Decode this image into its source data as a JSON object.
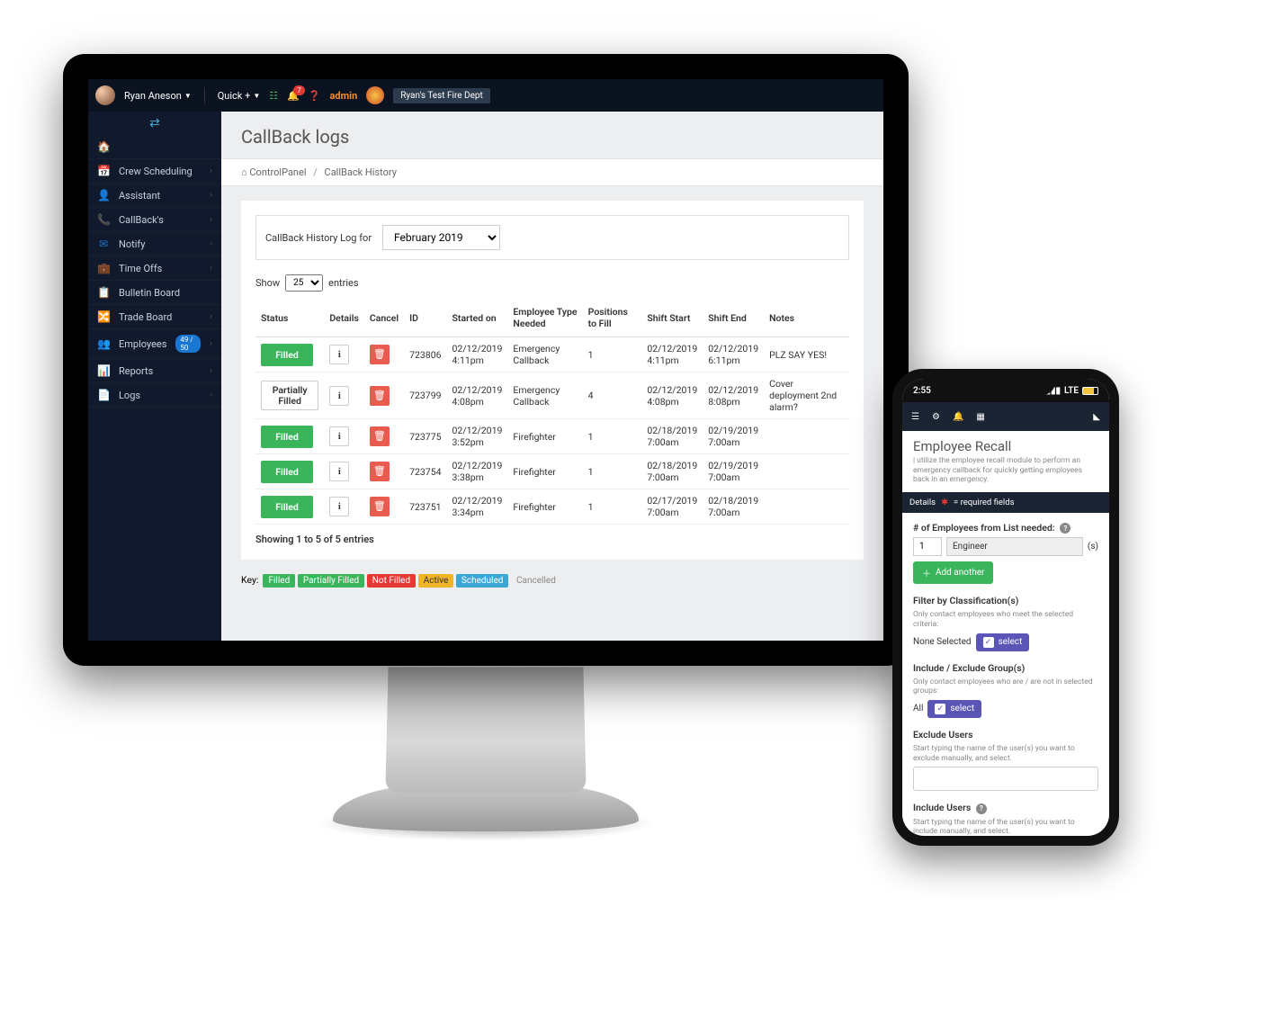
{
  "header": {
    "username": "Ryan Aneson",
    "quick": "Quick +",
    "notif_count": "7",
    "admin": "admin",
    "dept": "Ryan's Test Fire Dept"
  },
  "sidebar": {
    "items": [
      {
        "icon": "🏠",
        "label": ""
      },
      {
        "icon": "📅",
        "label": "Crew Scheduling",
        "chev": true,
        "color": "#4fa3d1"
      },
      {
        "icon": "👤",
        "label": "Assistant",
        "chev": true,
        "color": "#4fa3d1"
      },
      {
        "icon": "📞",
        "label": "CallBack's",
        "chev": true,
        "color": "#e53935"
      },
      {
        "icon": "✉",
        "label": "Notify",
        "chev": true,
        "color": "#1976d2"
      },
      {
        "icon": "💼",
        "label": "Time Offs",
        "chev": true,
        "color": "#f0a429"
      },
      {
        "icon": "📋",
        "label": "Bulletin Board",
        "color": "#ddd"
      },
      {
        "icon": "🔀",
        "label": "Trade Board",
        "chev": true,
        "color": "#1976d2"
      },
      {
        "icon": "👥",
        "label": "Employees",
        "badge": "49 / 50",
        "chev": true,
        "color": "#3bb55c"
      },
      {
        "icon": "📊",
        "label": "Reports",
        "chev": true,
        "color": "#1976d2"
      },
      {
        "icon": "📄",
        "label": "Logs",
        "chev": true,
        "color": "#aaa"
      }
    ]
  },
  "page": {
    "title": "CallBack logs"
  },
  "breadcrumb": {
    "home": "ControlPanel",
    "current": "CallBack History"
  },
  "selector": {
    "label": "CallBack History Log for",
    "value": "February 2019"
  },
  "entries": {
    "show": "Show",
    "count": "25",
    "suffix": "entries"
  },
  "table": {
    "columns": [
      "Status",
      "Details",
      "Cancel",
      "ID",
      "Started on",
      "Employee Type Needed",
      "Positions to Fill",
      "Shift Start",
      "Shift End",
      "Notes"
    ],
    "rows": [
      {
        "status": "Filled",
        "statusClass": "st-filled",
        "id": "723806",
        "started": "02/12/2019 4:11pm",
        "type": "Emergency Callback",
        "positions": "1",
        "start": "02/12/2019 4:11pm",
        "end": "02/12/2019 6:11pm",
        "notes": "PLZ SAY YES!"
      },
      {
        "status": "Partially Filled",
        "statusClass": "st-partial",
        "id": "723799",
        "started": "02/12/2019 4:08pm",
        "type": "Emergency Callback",
        "positions": "4",
        "start": "02/12/2019 4:08pm",
        "end": "02/12/2019 8:08pm",
        "notes": "Cover deployment 2nd alarm?"
      },
      {
        "status": "Filled",
        "statusClass": "st-filled",
        "id": "723775",
        "started": "02/12/2019 3:52pm",
        "type": "Firefighter",
        "positions": "1",
        "start": "02/18/2019 7:00am",
        "end": "02/19/2019 7:00am",
        "notes": ""
      },
      {
        "status": "Filled",
        "statusClass": "st-filled",
        "id": "723754",
        "started": "02/12/2019 3:38pm",
        "type": "Firefighter",
        "positions": "1",
        "start": "02/18/2019 7:00am",
        "end": "02/19/2019 7:00am",
        "notes": ""
      },
      {
        "status": "Filled",
        "statusClass": "st-filled",
        "id": "723751",
        "started": "02/12/2019 3:34pm",
        "type": "Firefighter",
        "positions": "1",
        "start": "02/17/2019 7:00am",
        "end": "02/18/2019 7:00am",
        "notes": ""
      }
    ],
    "showing": "Showing 1 to 5 of 5 entries"
  },
  "keyrow": {
    "label": "Key:",
    "items": [
      {
        "label": "Filled",
        "cls": "kp-filled"
      },
      {
        "label": "Partially Filled",
        "cls": "kp-partial"
      },
      {
        "label": "Not Filled",
        "cls": "kp-not"
      },
      {
        "label": "Active",
        "cls": "kp-active"
      },
      {
        "label": "Scheduled",
        "cls": "kp-sched"
      },
      {
        "label": "Cancelled",
        "cls": "kp-cancel"
      }
    ]
  },
  "phone": {
    "time": "2:55",
    "carrier": "LTE",
    "title": "Employee Recall",
    "subtitle": "| utilize the employee recall module to perform an emergency callback for quickly getting employees back in an emergency.",
    "strip_details": "Details",
    "strip_req": "= required fields",
    "emp_label": "# of Employees from List needed:",
    "emp_count": "1",
    "emp_role": "Engineer",
    "emp_suffix": "(s)",
    "add_another": "Add another",
    "filter_label": "Filter by Classification(s)",
    "filter_help": "Only contact employees who meet the selected criteria:",
    "filter_value": "None Selected",
    "select_btn": "select",
    "include_label": "Include / Exclude Group(s)",
    "include_help": "Only contact employees who are / are not in selected groups:",
    "include_value": "All",
    "exclude_label": "Exclude Users",
    "exclude_help": "Start typing the name of the user(s) you want to exclude manually, and select.",
    "include_users_label": "Include Users",
    "include_users_help": "Start typing the name of the user(s) you want to include manually, and select."
  }
}
